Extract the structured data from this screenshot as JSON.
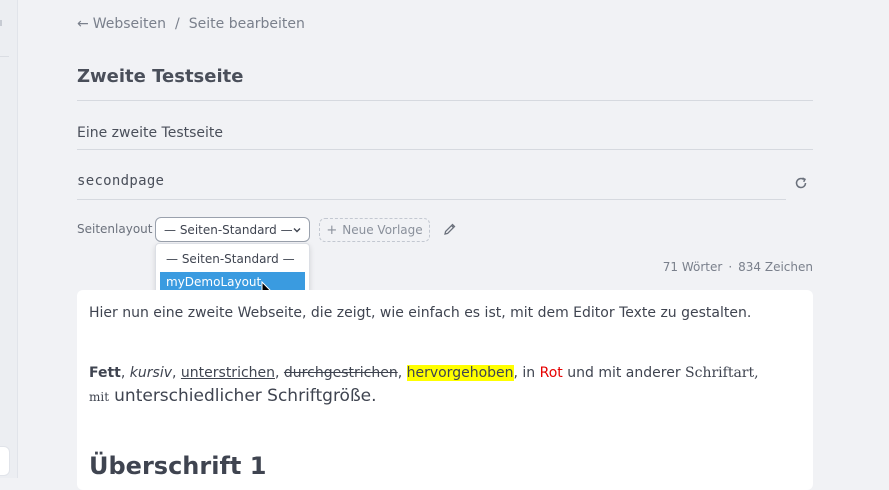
{
  "breadcrumb": {
    "back_label": "Webseiten",
    "separator": "/",
    "current": "Seite bearbeiten"
  },
  "page": {
    "title": "Zweite Testseite",
    "subtitle": "Eine zweite Testseite",
    "slug": "secondpage"
  },
  "layout": {
    "label": "Seitenlayout",
    "selected": "— Seiten-Standard —",
    "new_template_label": "Neue Vorlage",
    "options": [
      "— Seiten-Standard —",
      "myDemoLayout"
    ],
    "highlighted_option": "myDemoLayout"
  },
  "counts": {
    "words": "71 Wörter",
    "separator": "·",
    "chars": "834 Zeichen"
  },
  "editor": {
    "line1": "Hier nun eine zweite Webseite, die zeigt, wie einfach es ist, mit dem Editor Texte zu gestalten.",
    "bold": "Fett",
    "italic": "kursiv",
    "underline": "unterstrichen",
    "strike": "durchgestrichen",
    "highlight": "hervorgehoben",
    "in_text": "in",
    "red": "Rot",
    "other_font_pre": "und mit anderer",
    "other_font": "Schriftart,",
    "small_word": "mit",
    "large_text": "unterschiedlicher Schriftgröße",
    "heading1": "Überschrift 1"
  },
  "colors": {
    "accent_selected": "#3a9be0",
    "highlight": "#ffff00",
    "red_text": "#e60000",
    "background": "#f1f2f5"
  },
  "icons": {
    "back": "arrow-left-icon",
    "refresh": "refresh-icon",
    "plus": "plus-icon",
    "edit": "pencil-icon",
    "chevron": "chevron-down-icon"
  }
}
